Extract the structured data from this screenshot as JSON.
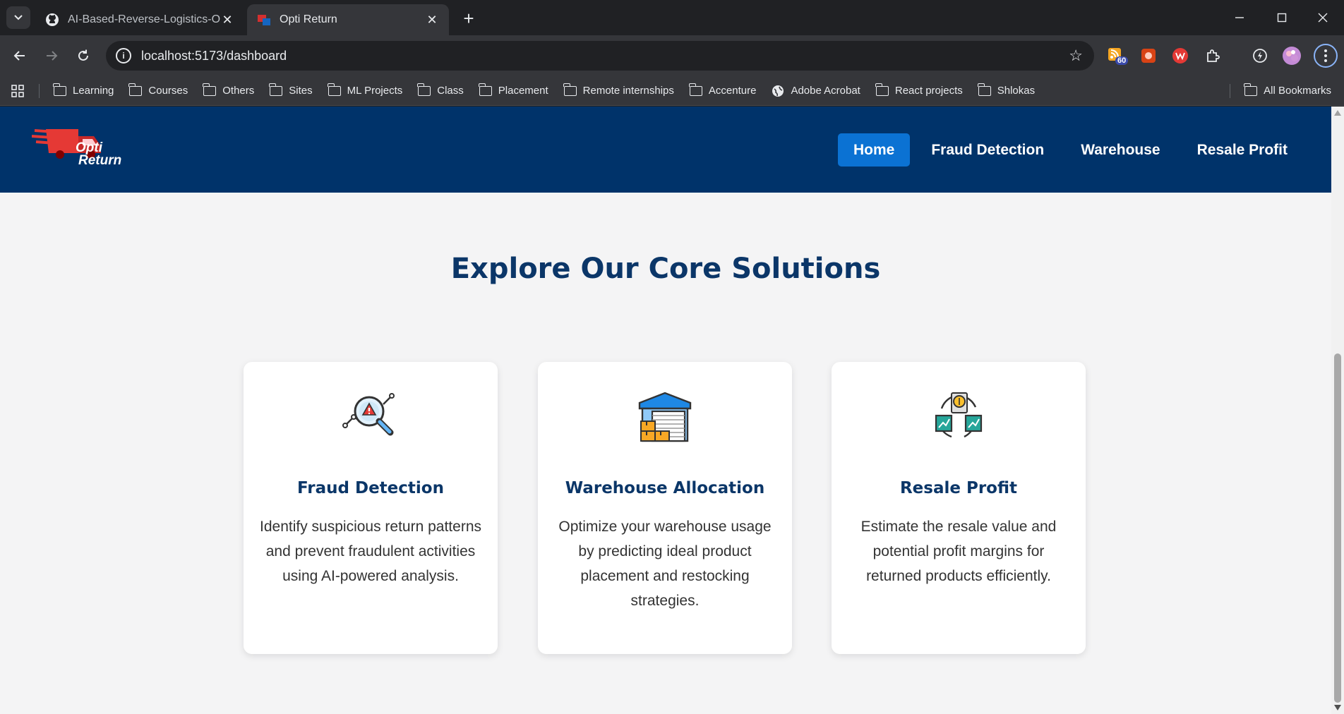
{
  "browser": {
    "tabs": [
      {
        "title": "AI-Based-Reverse-Logistics-Opt",
        "favicon": "github-icon",
        "active": false
      },
      {
        "title": "Opti Return",
        "favicon": "optireturn-icon",
        "active": true
      }
    ],
    "url": "localhost:5173/dashboard",
    "extension_badge": "60",
    "bookmarks": [
      "Learning",
      "Courses",
      "Others",
      "Sites",
      "ML Projects",
      "Class",
      "Placement",
      "Remote internships",
      "Accenture",
      "Adobe Acrobat",
      "React projects",
      "Shlokas"
    ],
    "all_bookmarks": "All Bookmarks"
  },
  "site": {
    "logo": {
      "line1": "Opti",
      "line2": "Return"
    },
    "nav": [
      {
        "label": "Home",
        "active": true
      },
      {
        "label": "Fraud Detection",
        "active": false
      },
      {
        "label": "Warehouse",
        "active": false
      },
      {
        "label": "Resale Profit",
        "active": false
      }
    ],
    "heading": "Explore Our Core Solutions",
    "cards": [
      {
        "title": "Fraud Detection",
        "description": "Identify suspicious return patterns and prevent fraudulent activities using AI-powered analysis.",
        "icon": "fraud-search-icon"
      },
      {
        "title": "Warehouse Allocation",
        "description": "Optimize your warehouse usage by predicting ideal product placement and restocking strategies.",
        "icon": "warehouse-icon"
      },
      {
        "title": "Resale Profit",
        "description": "Estimate the resale value and potential profit margins for returned products efficiently.",
        "icon": "resale-cycle-icon"
      }
    ]
  },
  "colors": {
    "navbar": "#00336a",
    "accent": "#0b72d3",
    "heading": "#0b3668",
    "page_bg": "#f4f4f5"
  }
}
